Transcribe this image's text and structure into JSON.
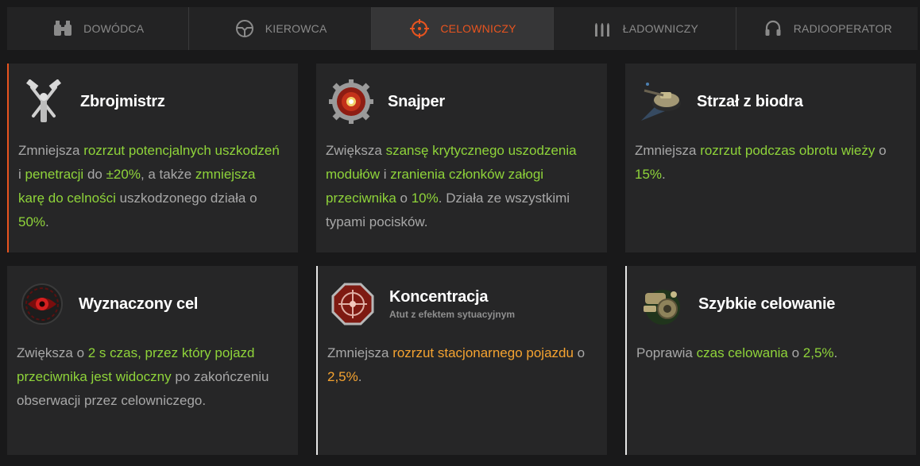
{
  "tabs": [
    {
      "label": "DOWÓDCA",
      "icon": "binoculars-icon",
      "active": false
    },
    {
      "label": "KIEROWCA",
      "icon": "steering-wheel-icon",
      "active": false
    },
    {
      "label": "CELOWNICZY",
      "icon": "crosshair-icon",
      "active": true
    },
    {
      "label": "ŁADOWNICZY",
      "icon": "shells-icon",
      "active": false
    },
    {
      "label": "RADIOOPERATOR",
      "icon": "headphones-icon",
      "active": false
    }
  ],
  "colors": {
    "accent": "#e8541f",
    "highlight_green": "#8fd43a",
    "highlight_orange": "#f5a330",
    "text": "#a8a8a8"
  },
  "cards": [
    {
      "title": "Zbrojmistrz",
      "icon": "crossed-hammers-icon",
      "desc": [
        {
          "t": "Zmniejsza ",
          "c": ""
        },
        {
          "t": "rozrzut potencjalnych uszkodzeń",
          "c": "g"
        },
        {
          "t": " i ",
          "c": ""
        },
        {
          "t": "penetracji",
          "c": "g"
        },
        {
          "t": " do ",
          "c": ""
        },
        {
          "t": "±20%",
          "c": "g"
        },
        {
          "t": ", a także ",
          "c": ""
        },
        {
          "t": "zmniejsza karę do celności",
          "c": "g"
        },
        {
          "t": " uszkodzonego działa o ",
          "c": ""
        },
        {
          "t": "50%",
          "c": "g"
        },
        {
          "t": ".",
          "c": ""
        }
      ]
    },
    {
      "title": "Snajper",
      "icon": "gear-target-icon",
      "desc": [
        {
          "t": "Zwiększa ",
          "c": ""
        },
        {
          "t": "szansę krytycznego uszodzenia modułów",
          "c": "g"
        },
        {
          "t": " i ",
          "c": ""
        },
        {
          "t": "zranienia członków załogi przeciwnika",
          "c": "g"
        },
        {
          "t": " o ",
          "c": ""
        },
        {
          "t": "10%",
          "c": "g"
        },
        {
          "t": ". Działa ze wszystkimi typami pocisków.",
          "c": ""
        }
      ]
    },
    {
      "title": "Strzał z biodra",
      "icon": "turret-icon",
      "desc": [
        {
          "t": "Zmniejsza ",
          "c": ""
        },
        {
          "t": "rozrzut podczas obrotu wieży",
          "c": "g"
        },
        {
          "t": " o ",
          "c": ""
        },
        {
          "t": "15%",
          "c": "g"
        },
        {
          "t": ".",
          "c": ""
        }
      ]
    },
    {
      "title": "Wyznaczony cel",
      "icon": "red-eye-icon",
      "desc": [
        {
          "t": "Zwiększa o ",
          "c": ""
        },
        {
          "t": "2 s czas, przez który pojazd przeciwnika jest widoczny",
          "c": "g"
        },
        {
          "t": " po zakończeniu obserwacji przez celowniczego.",
          "c": ""
        }
      ]
    },
    {
      "title": "Koncentracja",
      "subtitle": "Atut z efektem sytuacyjnym",
      "icon": "octagon-target-icon",
      "desc": [
        {
          "t": "Zmniejsza ",
          "c": ""
        },
        {
          "t": "rozrzut stacjonarnego pojazdu",
          "c": "o"
        },
        {
          "t": " o ",
          "c": ""
        },
        {
          "t": "2,5%",
          "c": "o"
        },
        {
          "t": ".",
          "c": ""
        }
      ]
    },
    {
      "title": "Szybkie celowanie",
      "icon": "gun-sight-icon",
      "desc": [
        {
          "t": "Poprawia ",
          "c": ""
        },
        {
          "t": "czas celowania",
          "c": "g"
        },
        {
          "t": " o ",
          "c": ""
        },
        {
          "t": "2,5%",
          "c": "g"
        },
        {
          "t": ".",
          "c": ""
        }
      ]
    }
  ]
}
